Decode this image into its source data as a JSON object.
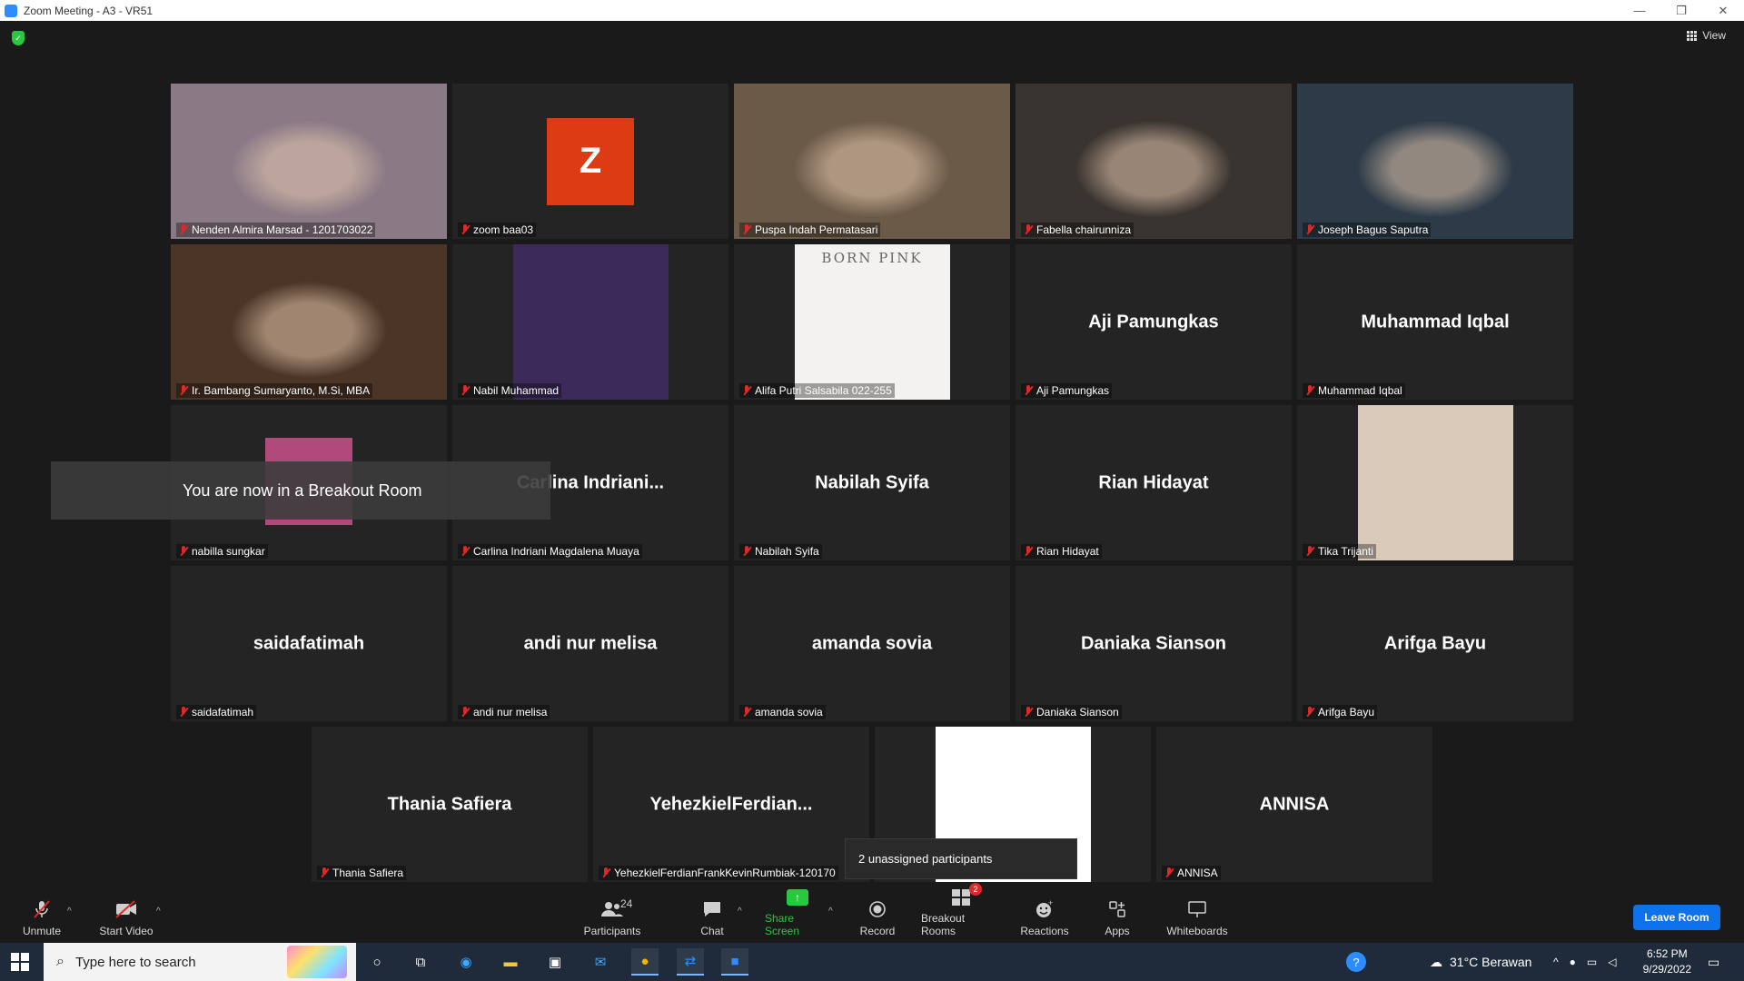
{
  "window": {
    "title": "Zoom Meeting - A3 - VR51",
    "minimize": "—",
    "restore": "❐",
    "close": "✕"
  },
  "top": {
    "view_label": "View"
  },
  "tiles": [
    {
      "name": "Nenden Almira Marsad - 1201703022",
      "display": "",
      "type": "photo",
      "bg": "#8a7a86"
    },
    {
      "name": "zoom baa03",
      "display": "",
      "type": "avatar",
      "avatar_letter": "Z",
      "bg": "#242424"
    },
    {
      "name": "Puspa Indah Permatasari",
      "display": "",
      "type": "photo",
      "bg": "#6b5a48"
    },
    {
      "name": "Fabella chairunniza",
      "display": "",
      "type": "photo",
      "bg": "#3a3430"
    },
    {
      "name": "Joseph Bagus Saputra",
      "display": "",
      "type": "photo",
      "bg": "#2d3b48"
    },
    {
      "name": "Ir. Bambang Sumaryanto, M.Si, MBA",
      "display": "",
      "type": "photo",
      "bg": "#4a3526",
      "active": true
    },
    {
      "name": "Nabil Muhammad",
      "display": "",
      "type": "inner",
      "bg": "#242424",
      "inner_bg": "#3b2a5a"
    },
    {
      "name": "Alifa Putri Salsabila 022-255",
      "display": "",
      "type": "inner",
      "bg": "#242424",
      "inner_bg": "#f4f2f0",
      "inner_caption": "BORN PINK"
    },
    {
      "name": "Aji Pamungkas",
      "display": "Aji Pamungkas",
      "type": "name"
    },
    {
      "name": "Muhammad Iqbal",
      "display": "Muhammad Iqbal",
      "type": "name"
    },
    {
      "name": "nabilla sungkar",
      "display": "",
      "type": "inner",
      "bg": "#242424",
      "inner_bg": "#b04a7a"
    },
    {
      "name": "Carlina Indriani Magdalena Muaya",
      "display": "Carlina  Indriani...",
      "type": "name"
    },
    {
      "name": "Nabilah Syifa",
      "display": "Nabilah Syifa",
      "type": "name"
    },
    {
      "name": "Rian Hidayat",
      "display": "Rian Hidayat",
      "type": "name"
    },
    {
      "name": "Tika Trijanti",
      "display": "",
      "type": "inner",
      "bg": "#242424",
      "inner_bg": "#d9c9b8"
    },
    {
      "name": "saidafatimah",
      "display": "saidafatimah",
      "type": "name"
    },
    {
      "name": "andi nur melisa",
      "display": "andi nur melisa",
      "type": "name"
    },
    {
      "name": "amanda sovia",
      "display": "amanda sovia",
      "type": "name"
    },
    {
      "name": "Daniaka Sianson",
      "display": "Daniaka Sianson",
      "type": "name"
    },
    {
      "name": "Arifga Bayu",
      "display": "Arifga Bayu",
      "type": "name"
    },
    {
      "name": "Thania Safiera",
      "display": "Thania Safiera",
      "type": "name"
    },
    {
      "name": "YehezkielFerdianFrankKevinRumbiak-120170",
      "display": "YehezkielFerdian...",
      "type": "name"
    },
    {
      "name": "",
      "display": "",
      "type": "inner",
      "bg": "#242424",
      "inner_bg": "#ffffff"
    },
    {
      "name": "ANNISA",
      "display": "ANNISA",
      "type": "name"
    }
  ],
  "toast": "You are now in a Breakout Room",
  "unassigned_popup": "2 unassigned participants",
  "toolbar": {
    "unmute": "Unmute",
    "start_video": "Start Video",
    "participants": "Participants",
    "participants_count": "24",
    "chat": "Chat",
    "share_screen": "Share Screen",
    "record": "Record",
    "breakout_rooms": "Breakout Rooms",
    "breakout_badge": "2",
    "reactions": "Reactions",
    "apps": "Apps",
    "whiteboards": "Whiteboards",
    "leave": "Leave Room"
  },
  "taskbar": {
    "search_placeholder": "Type here to search",
    "weather": "31°C  Berawan",
    "time": "6:52 PM",
    "date": "9/29/2022"
  },
  "colors": {
    "active_speaker": "#d6f04d",
    "leave": "#0e72ed",
    "share": "#27c93f",
    "muted": "#e02828"
  }
}
